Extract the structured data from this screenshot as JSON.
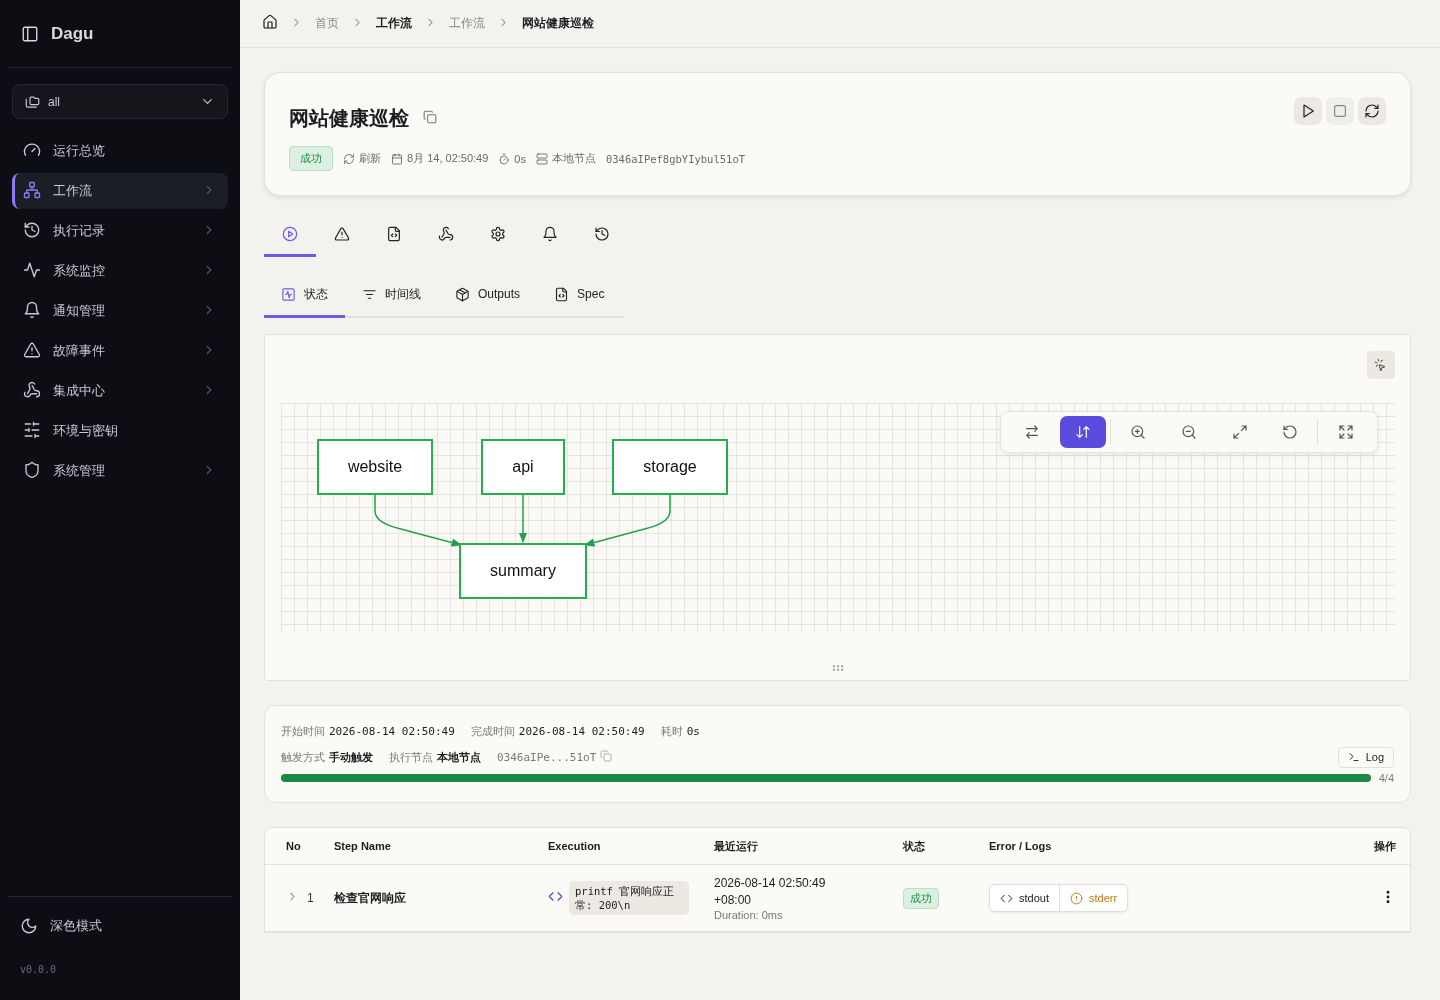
{
  "sidebar": {
    "brand": "Dagu",
    "workspace": "all",
    "items": [
      {
        "label": "运行总览",
        "selected": false,
        "expandable": false
      },
      {
        "label": "工作流",
        "selected": true,
        "expandable": true
      },
      {
        "label": "执行记录",
        "selected": false,
        "expandable": true
      },
      {
        "label": "系统监控",
        "selected": false,
        "expandable": true
      },
      {
        "label": "通知管理",
        "selected": false,
        "expandable": true
      },
      {
        "label": "故障事件",
        "selected": false,
        "expandable": true
      },
      {
        "label": "集成中心",
        "selected": false,
        "expandable": true
      },
      {
        "label": "环境与密钥",
        "selected": false,
        "expandable": false
      },
      {
        "label": "系统管理",
        "selected": false,
        "expandable": true
      }
    ],
    "theme_toggle": "深色模式",
    "version": "v0.0.0"
  },
  "breadcrumb": [
    {
      "label": "首页",
      "current": false,
      "strong": false
    },
    {
      "label": "工作流",
      "current": false,
      "strong": true
    },
    {
      "label": "工作流",
      "current": false,
      "strong": false
    },
    {
      "label": "网站健康巡检",
      "current": true,
      "strong": true
    }
  ],
  "header": {
    "title": "网站健康巡检",
    "status": "成功",
    "refresh": "刷新",
    "date": "8月 14, 02:50:49",
    "duration": "0s",
    "node_label": "本地节点",
    "node_id": "0346aIPef8gbYIybul51oT"
  },
  "icon_tabs": [
    {
      "selected": true
    },
    {
      "selected": false
    },
    {
      "selected": false
    },
    {
      "selected": false
    },
    {
      "selected": false
    },
    {
      "selected": false
    },
    {
      "selected": false
    }
  ],
  "tabs": [
    {
      "label": "状态",
      "selected": true
    },
    {
      "label": "时间线",
      "selected": false
    },
    {
      "label": "Outputs",
      "selected": false
    },
    {
      "label": "Spec",
      "selected": false
    }
  ],
  "graph": {
    "toolbar": [
      {
        "selected": false
      },
      {
        "selected": true
      },
      {
        "selected": false
      },
      {
        "selected": false
      },
      {
        "selected": false
      },
      {
        "selected": false
      },
      {
        "selected": false
      }
    ],
    "nodes": [
      {
        "label": "website"
      },
      {
        "label": "api"
      },
      {
        "label": "storage"
      },
      {
        "label": "summary"
      }
    ]
  },
  "summary": {
    "timing": [
      {
        "label": "开始时间",
        "value": "2026-08-14 02:50:49",
        "kind": "mono"
      },
      {
        "label": "完成时间",
        "value": "2026-08-14 02:50:49",
        "kind": "mono"
      },
      {
        "label": "耗时",
        "value": "0s",
        "kind": "mono"
      }
    ],
    "execution": [
      {
        "label": "触发方式",
        "value": "手动触发",
        "kind": "text"
      },
      {
        "label": "执行节点",
        "value": "本地节点",
        "kind": "text"
      },
      {
        "value": "0346aIPe...51oT",
        "kind": "id"
      }
    ],
    "log_button": "Log",
    "level": 1,
    "progress": "4/4"
  },
  "steps": {
    "columns": [
      "No",
      "Step Name",
      "Execution",
      "最近运行",
      "状态",
      "Error / Logs",
      "操作"
    ],
    "rows": [
      {
        "no": "1",
        "name": "检查官网响应",
        "expanded": false,
        "command": "printf 官网响应正常: 200\\n",
        "last_run": "2026-08-14 02:50:49 +08:00",
        "duration": "Duration: 0ms",
        "status": "成功",
        "stdout": "stdout",
        "stderr": "stderr"
      }
    ]
  }
}
